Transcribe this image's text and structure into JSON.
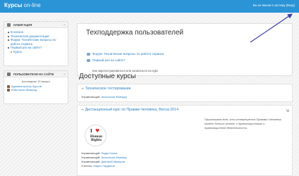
{
  "header": {
    "brand": "Курсы",
    "brand_suffix": "on-line",
    "login_info": "Вы не вошли в систему (Вход)"
  },
  "navigation": {
    "title": "НАВИГАЦИЯ",
    "items": [
      {
        "label": "В начало",
        "indent": false
      },
      {
        "label": "Техническая документация",
        "indent": false
      },
      {
        "label": "Форум: Технические вопросы по работе сервиса",
        "indent": false
      },
      {
        "label": "Первый раз на сайте?",
        "indent": false
      },
      {
        "label": "Курсы",
        "indent": true
      }
    ]
  },
  "users_online": {
    "title": "ПОЛЬЗОВАТЕЛИ НА САЙТЕ",
    "period": "(последние 15 минут)",
    "users": [
      "Администратор Курсов",
      "Анастасия Жмерид"
    ]
  },
  "support": {
    "title": "Техподдержка пользователей",
    "links": [
      "Форум: Технические вопросы по работе сервиса",
      "Первый раз на сайте?"
    ],
    "not_signed_note": "Как зарегистрироваться или записаться на курс"
  },
  "courses": {
    "title": "Доступные курсы",
    "list": [
      {
        "name": "Техническое тестирование",
        "teachers": [
          {
            "role": "Управляющий:",
            "name": "Анастасия Жмерид"
          }
        ]
      },
      {
        "name": "Дистанционный курс по Правам Человека, Весна 2014",
        "logo": {
          "letter": "I",
          "line1": "Human",
          "line2": "Rights"
        },
        "description": "Приглашаем всех, кто интересуется Правами Человека, может больше узнать о правозащитниках и правозащитной деятельности.",
        "teachers": [
          {
            "role": "Управляющий:",
            "name": "Нaдia Sosna"
          },
          {
            "role": "Управляющий:",
            "name": "Анастасия Жмерид"
          },
          {
            "role": "Управляющий:",
            "name": "Дмитрий Макаров"
          },
          {
            "role": "Учитель:",
            "name": "Марат Гарданов"
          }
        ]
      }
    ]
  },
  "colors": {
    "accent": "#2a94d6",
    "link": "#2a7fc1"
  }
}
